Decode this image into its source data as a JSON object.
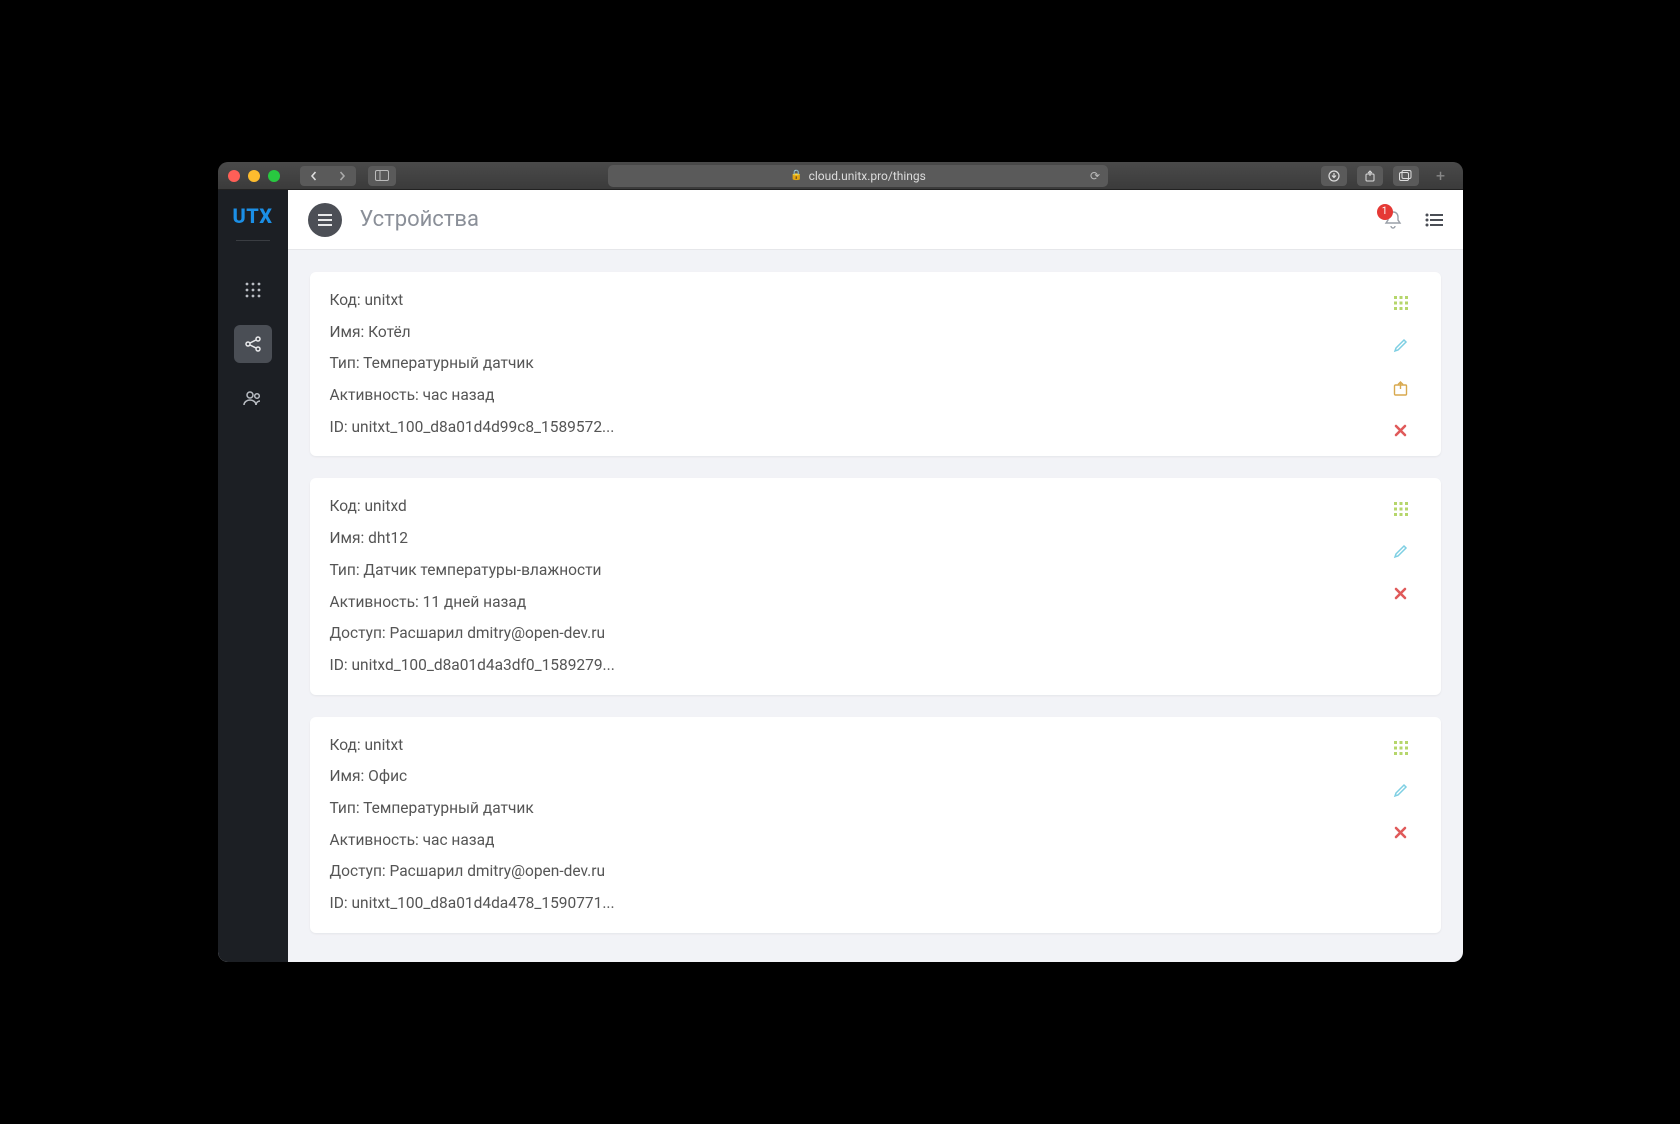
{
  "browser": {
    "url": "cloud.unitx.pro/things"
  },
  "app": {
    "logo": "UTX",
    "title": "Устройства",
    "notification_count": "1"
  },
  "labels": {
    "code": "Код",
    "name": "Имя",
    "type": "Тип",
    "activity": "Активность",
    "access": "Доступ",
    "id": "ID"
  },
  "devices": [
    {
      "code": "unitxt",
      "name": "Котёл",
      "type": "Температурный датчик",
      "activity": "час назад",
      "access": "",
      "id": "unitxt_100_d8a01d4d99c8_1589572...",
      "has_share": true
    },
    {
      "code": "unitxd",
      "name": "dht12",
      "type": "Датчик температуры-влажности",
      "activity": "11 дней назад",
      "access": "Расшарил dmitry@open-dev.ru",
      "id": "unitxd_100_d8a01d4a3df0_1589279...",
      "has_share": false
    },
    {
      "code": "unitxt",
      "name": "Офис",
      "type": "Температурный датчик",
      "activity": "час назад",
      "access": "Расшарил dmitry@open-dev.ru",
      "id": "unitxt_100_d8a01d4da478_1590771...",
      "has_share": false
    }
  ]
}
